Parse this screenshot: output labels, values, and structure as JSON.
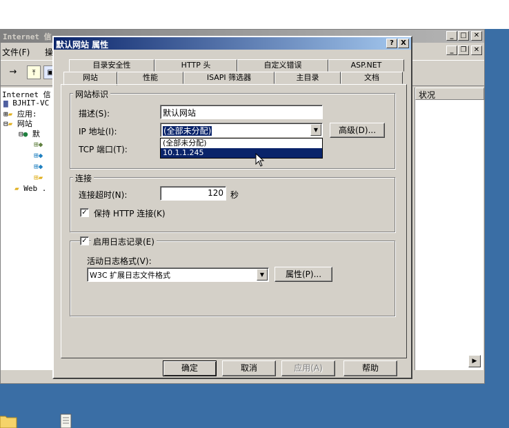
{
  "background_window": {
    "title": "Internet 信",
    "menu": [
      "文件(F)",
      "操"
    ],
    "tree": [
      "Internet 信",
      "BJHIT-VC",
      "应用:",
      "网站",
      "默",
      "Web ."
    ],
    "right_pane_header": "状况"
  },
  "dialog": {
    "title": "默认网站 属性",
    "help_btn": "?",
    "close_btn": "X",
    "tabs_row1": [
      "目录安全性",
      "HTTP 头",
      "自定义错误",
      "ASP.NET"
    ],
    "tabs_row2": [
      "网站",
      "性能",
      "ISAPI 筛选器",
      "主目录",
      "文档"
    ],
    "website_id": {
      "group_label": "网站标识",
      "description_label": "描述(S):",
      "description_value": "默认网站",
      "ip_label": "IP 地址(I):",
      "ip_value": "(全部未分配)",
      "advanced_button": "高级(D)...",
      "tcp_label": "TCP 端口(T):",
      "ip_options": [
        "(全部未分配)",
        "10.1.1.245"
      ]
    },
    "connections": {
      "group_label": "连接",
      "timeout_label": "连接超时(N):",
      "timeout_value": "120",
      "timeout_unit": "秒",
      "keepalive_label": "保持 HTTP 连接(K)",
      "keepalive_checked": true
    },
    "logging": {
      "enable_label": "启用日志记录(E)",
      "enabled": true,
      "format_label": "活动日志格式(V):",
      "format_value": "W3C 扩展日志文件格式",
      "properties_button": "属性(P)..."
    },
    "buttons": {
      "ok": "确定",
      "cancel": "取消",
      "apply": "应用(A)",
      "help": "帮助"
    }
  }
}
